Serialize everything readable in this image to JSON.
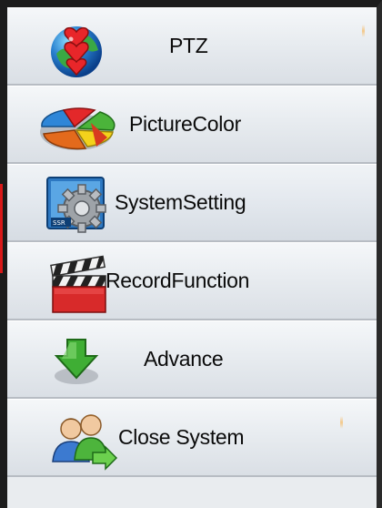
{
  "menu": {
    "items": [
      {
        "label": "PTZ",
        "icon": "ptz-globe-hearts-icon"
      },
      {
        "label": "PictureColor",
        "icon": "color-pie-icon"
      },
      {
        "label": "SystemSetting",
        "icon": "system-gear-icon"
      },
      {
        "label": "RecordFunction",
        "icon": "clapperboard-icon"
      },
      {
        "label": "Advance",
        "icon": "green-down-arrow-icon"
      },
      {
        "label": "Close System",
        "icon": "users-exit-icon"
      }
    ],
    "selected_index": 2
  },
  "colors": {
    "accent_marker": "#d81818",
    "item_border": "#b7bcc3",
    "frame": "#1c1c1c"
  }
}
